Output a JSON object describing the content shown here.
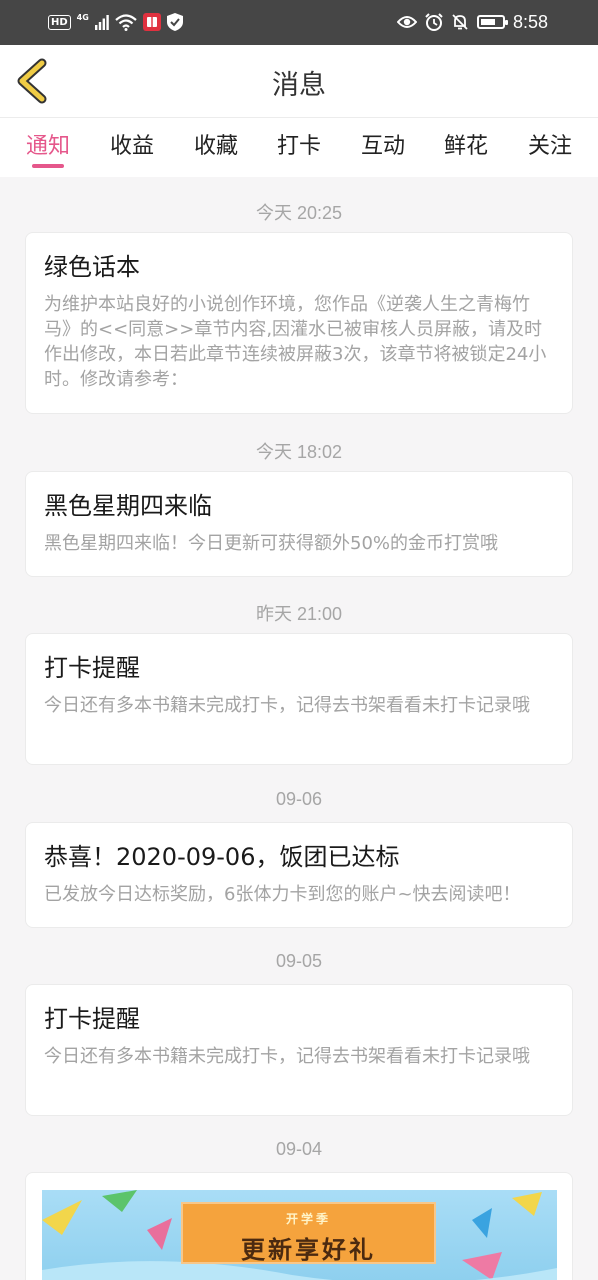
{
  "status_bar": {
    "badge": "HD",
    "network": "4G",
    "time": "8:58"
  },
  "header": {
    "title": "消息"
  },
  "tabs": [
    {
      "label": "通知",
      "active": true
    },
    {
      "label": "收益"
    },
    {
      "label": "收藏"
    },
    {
      "label": "打卡"
    },
    {
      "label": "互动"
    },
    {
      "label": "鲜花"
    },
    {
      "label": "关注"
    }
  ],
  "colors": {
    "accent": "#e5578b",
    "back_arrow": "#f0cc45",
    "status_bar": "#464646"
  },
  "messages": [
    {
      "time": "今天 20:25",
      "title": "绿色话本",
      "body": "为维护本站良好的小说创作环境，您作品《逆袭人生之青梅竹马》的<<同意>>章节内容,因灌水已被审核人员屏蔽，请及时作出修改，本日若此章节连续被屏蔽3次，该章节将被锁定24小时。修改请参考："
    },
    {
      "time": "今天 18:02",
      "title": "黑色星期四来临",
      "body": "黑色星期四来临！今日更新可获得额外50%的金币打赏哦"
    },
    {
      "time": "昨天 21:00",
      "title": "打卡提醒",
      "body": "今日还有多本书籍未完成打卡，记得去书架看看未打卡记录哦"
    },
    {
      "time": "09-06",
      "title": "恭喜！2020-09-06，饭团已达标",
      "body": "已发放今日达标奖励，6张体力卡到您的账户~快去阅读吧！"
    },
    {
      "time": "09-05",
      "title": "打卡提醒",
      "body": "今日还有多本书籍未完成打卡，记得去书架看看未打卡记录哦"
    },
    {
      "time": "09-04",
      "banner": {
        "subtitle": "开学季",
        "title": "更新享好礼"
      }
    }
  ]
}
